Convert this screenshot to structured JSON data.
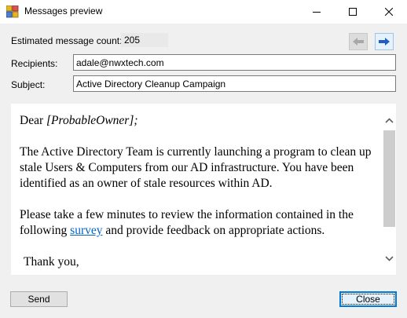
{
  "window": {
    "title": "Messages preview"
  },
  "header": {
    "count_label": "Estimated message count:",
    "count_value": "205"
  },
  "fields": {
    "recipients_label": "Recipients:",
    "recipients_value": "adale@nwxtech.com",
    "subject_label": "Subject:",
    "subject_value": "Active Directory Cleanup Campaign"
  },
  "message": {
    "greeting_prefix": "Dear ",
    "greeting_placeholder": "[ProbableOwner];",
    "paragraph1": "The Active Directory Team is currently launching a program to clean up stale Users & Computers from our AD infrastructure. You have been identified as an owner of stale resources within AD.",
    "paragraph2_before": "Please take a few minutes to review the information contained in the following ",
    "paragraph2_link": "survey",
    "paragraph2_after": " and provide feedback on appropriate actions.",
    "closing": "Thank you,"
  },
  "buttons": {
    "send_label": "Send",
    "close_label": "Close"
  },
  "icons": {
    "prev": "arrow-left-icon",
    "next": "arrow-right-icon",
    "scroll_up": "chevron-up-icon",
    "scroll_down": "chevron-down-icon"
  },
  "colors": {
    "link": "#0563c1",
    "focus_border": "#0078d7",
    "next_arrow": "#1f5fbf"
  }
}
